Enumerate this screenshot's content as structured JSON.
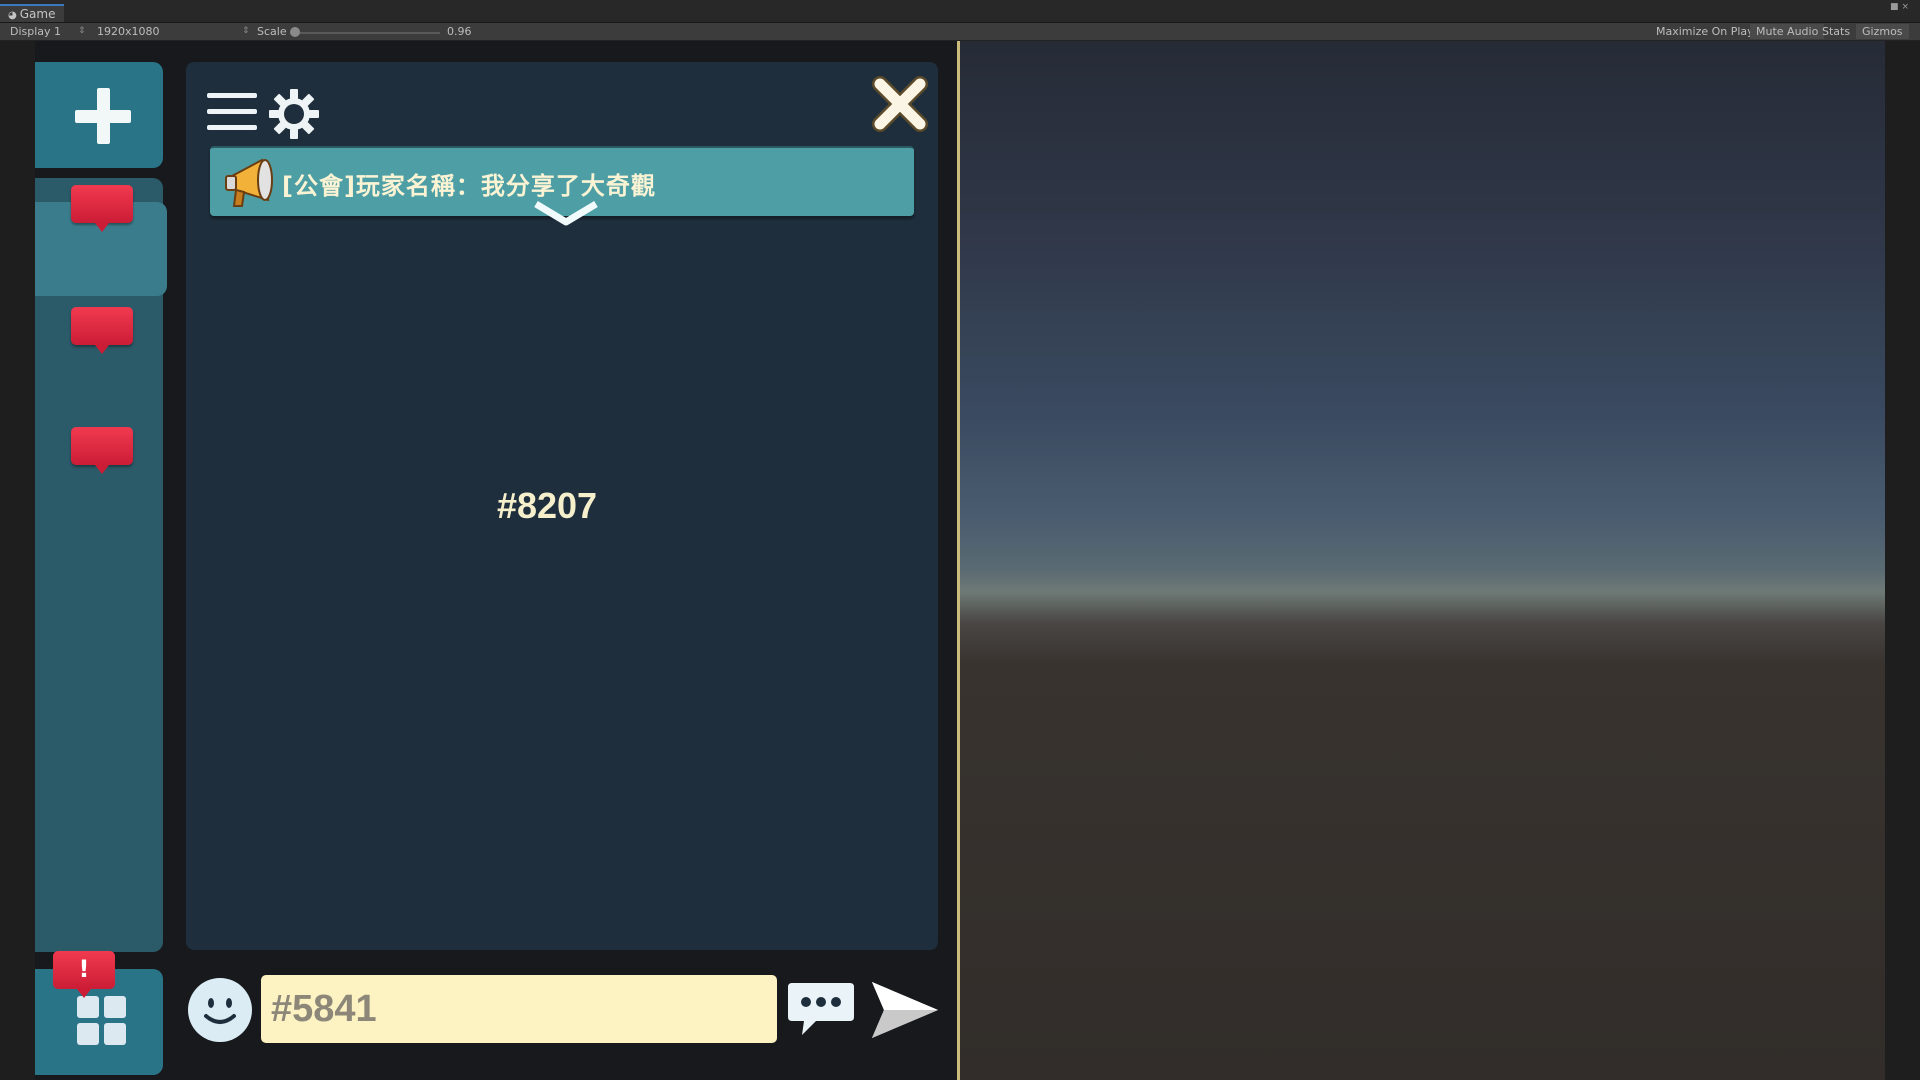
{
  "editor": {
    "tab_label": "Game",
    "display_label": "Display 1",
    "resolution_label": "1920x1080",
    "scale_label": "Scale",
    "scale_value": "0.96",
    "toolbar_buttons": [
      "Maximize On Play",
      "Mute Audio",
      "Stats",
      "Gizmos"
    ]
  },
  "chat": {
    "announcement": "[公會]玩家名稱：我分享了大奇觀",
    "center_text": "#8207",
    "input_placeholder": "#5841"
  },
  "sidebar": {
    "alert_badge": "!"
  },
  "icons": {
    "menu": "menu-icon",
    "settings": "gear-icon",
    "close": "close-icon",
    "announcement": "megaphone-icon",
    "expand": "chevron-down-icon",
    "emoji": "smiley-icon",
    "quick_chat": "speech-bubble-icon",
    "send": "send-icon",
    "add": "plus-icon",
    "apps": "grid-icon"
  },
  "colors": {
    "panel_bg": "#1e2e3c",
    "sidebar_tab": "#2a7488",
    "badge": "#e52b44",
    "announce_bg": "#4e9ea5",
    "input_bg": "#fdf2c2",
    "accent_text": "#f6efcc"
  }
}
